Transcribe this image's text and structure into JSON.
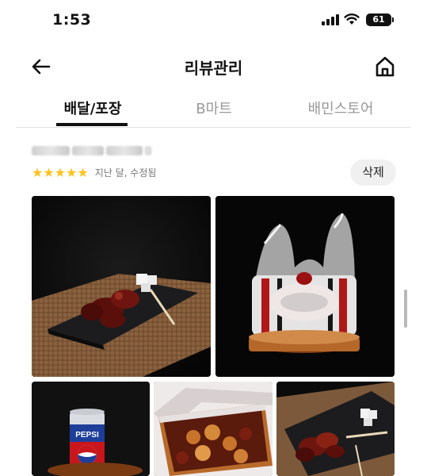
{
  "status_bar": {
    "time": "1:53",
    "battery": "61"
  },
  "header": {
    "title": "리뷰관리",
    "back_icon": "arrow-left-icon",
    "home_icon": "home-icon"
  },
  "tabs": [
    {
      "label": "배달/포장",
      "active": true
    },
    {
      "label": "B마트",
      "active": false
    },
    {
      "label": "배민스토어",
      "active": false
    }
  ],
  "review": {
    "rating": 5,
    "stars": "★★★★★",
    "meta": "지난 달, 수정됨",
    "delete_label": "삭제",
    "star_color": "#ffc21c"
  },
  "photos": [
    {
      "description": "chicken-plate-photo"
    },
    {
      "description": "takeout-bag-photo"
    },
    {
      "description": "pepsi-can-photo",
      "text": "PEPSI"
    },
    {
      "description": "chicken-box-photo"
    },
    {
      "description": "chicken-plate-closeup-photo"
    }
  ]
}
